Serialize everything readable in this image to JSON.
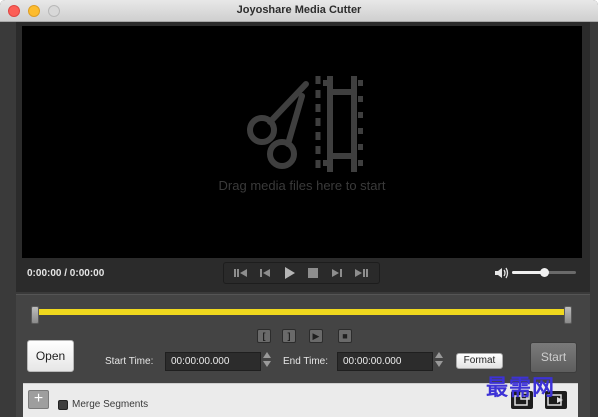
{
  "window": {
    "title": "Joyoshare Media Cutter"
  },
  "preview": {
    "placeholder": "Drag media files here to start"
  },
  "playback": {
    "time_readout": "0:00:00 / 0:00:00",
    "volume_level": 0.5,
    "buttons": [
      "previous-frame-icon",
      "step-back-icon",
      "play-icon",
      "stop-icon",
      "step-forward-icon",
      "next-frame-icon"
    ]
  },
  "timeline": {
    "progress": 1.0,
    "accent_color": "#f0d81e"
  },
  "controls": {
    "open_label": "Open",
    "start_time_label": "Start Time:",
    "start_time_value": "00:00:00.000",
    "end_time_label": "End Time:",
    "end_time_value": "00:00:00.000",
    "format_label": "Format",
    "start_label": "Start"
  },
  "merge": {
    "label": "Merge Segments",
    "checked": false
  },
  "watermark": {
    "text": "最需网"
  }
}
